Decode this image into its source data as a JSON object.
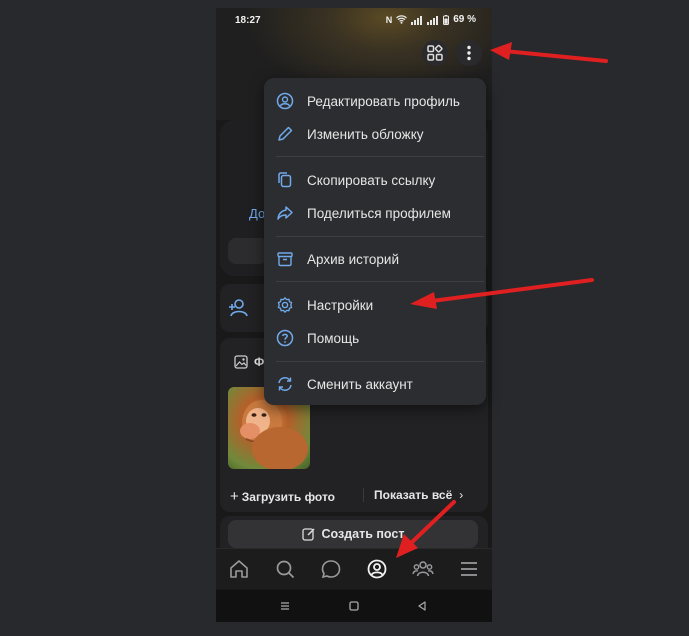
{
  "status": {
    "time": "18:27",
    "battery": "69 %"
  },
  "menu": {
    "items": [
      {
        "label": "Редактировать профиль",
        "icon": "user-circle-icon"
      },
      {
        "label": "Изменить обложку",
        "icon": "pencil-icon"
      },
      {
        "label": "Скопировать ссылку",
        "icon": "copy-icon"
      },
      {
        "label": "Поделиться профилем",
        "icon": "share-icon"
      },
      {
        "label": "Архив историй",
        "icon": "archive-icon"
      },
      {
        "label": "Настройки",
        "icon": "gear-icon"
      },
      {
        "label": "Помощь",
        "icon": "help-icon"
      },
      {
        "label": "Сменить аккаунт",
        "icon": "switch-account-icon"
      }
    ]
  },
  "profile": {
    "partial_link": "До",
    "photos_label": "Ф",
    "upload_label": "Загрузить фото",
    "show_all_label": "Показать всё",
    "create_post_label": "Создать пост"
  },
  "nav": [
    "home-icon",
    "search-icon",
    "messages-icon",
    "profile-icon",
    "friends-icon",
    "menu-icon"
  ],
  "colors": {
    "accent": "#5181b8",
    "annotation_arrow": "#e02020"
  }
}
